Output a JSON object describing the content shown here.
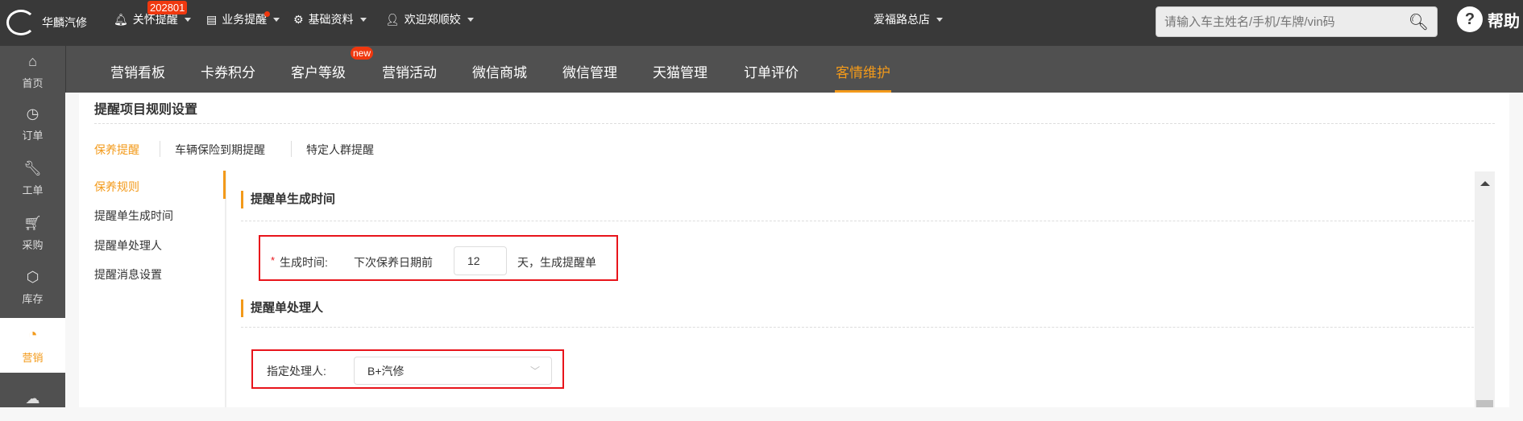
{
  "header": {
    "brand": "华麟汽修",
    "menus": [
      {
        "label": "关怀提醒",
        "badge": "202801",
        "icon": "bell-icon"
      },
      {
        "label": "业务提醒",
        "icon": "document-icon"
      },
      {
        "label": "基础资料",
        "icon": "gear-icon"
      },
      {
        "label": "欢迎郑顺姣",
        "icon": "user-icon"
      }
    ],
    "store": "爱福路总店",
    "search_placeholder": "请输入车主姓名/手机/车牌/vin码",
    "help": "帮助"
  },
  "nav": {
    "tabs": [
      "营销看板",
      "卡券积分",
      "客户等级",
      "营销活动",
      "微信商城",
      "微信管理",
      "天猫管理",
      "订单评价",
      "客情维护"
    ],
    "new_badge": "new",
    "active": "客情维护"
  },
  "sidebar": {
    "items": [
      {
        "label": "首页",
        "icon": "home-icon"
      },
      {
        "label": "订单",
        "icon": "clock-icon"
      },
      {
        "label": "工单",
        "icon": "wrench-icon"
      },
      {
        "label": "采购",
        "icon": "cart-icon"
      },
      {
        "label": "库存",
        "icon": "box-icon"
      },
      {
        "label": "营销",
        "icon": "pie-chart-icon"
      },
      {
        "label": "",
        "icon": "cloud-icon"
      }
    ],
    "active": "营销"
  },
  "page": {
    "title": "提醒项目规则设置",
    "subtabs": [
      "保养提醒",
      "车辆保险到期提醒",
      "特定人群提醒"
    ],
    "left_menu": [
      "保养规则",
      "提醒单生成时间",
      "提醒单处理人",
      "提醒消息设置"
    ],
    "section1": {
      "title": "提醒单生成时间",
      "required": "*",
      "label": "生成时间:",
      "prefix": "下次保养日期前",
      "value": "12",
      "suffix": "天，生成提醒单"
    },
    "section2": {
      "title": "提醒单处理人",
      "label": "指定处理人:",
      "selected": "B+汽修"
    }
  },
  "colors": {
    "accent": "#f39a1a",
    "highlight": "#e8141b",
    "topbar": "#393939",
    "navbar": "#505050"
  }
}
